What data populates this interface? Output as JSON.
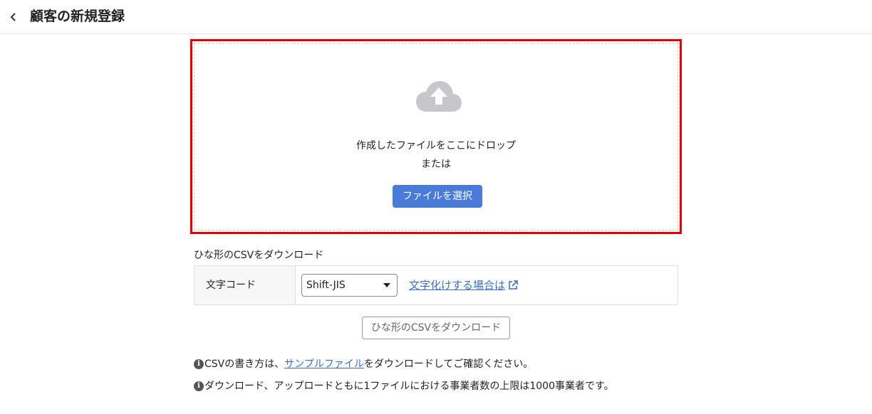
{
  "header": {
    "title": "顧客の新規登録"
  },
  "dropzone": {
    "drop_text": "作成したファイルをここにドロップ",
    "or_text": "または",
    "select_button": "ファイルを選択"
  },
  "template": {
    "section_label": "ひな形のCSVをダウンロード",
    "encoding_label": "文字コード",
    "encoding_value": "Shift-JIS",
    "garble_link": "文字化けする場合は",
    "download_button": "ひな形のCSVをダウンロード"
  },
  "notes": {
    "note1_prefix": "CSVの書き方は、",
    "note1_link": "サンプルファイル",
    "note1_suffix": "をダウンロードしてご確認ください。",
    "note2": "ダウンロード、アップロードともに1ファイルにおける事業者数の上限は1000事業者です。"
  },
  "colors": {
    "accent": "#4a7bd8",
    "highlight_border": "#e00000",
    "link": "#3a6fc4"
  },
  "icons": [
    "chevron-left-icon",
    "cloud-upload-icon",
    "external-link-icon",
    "info-icon",
    "caret-down-icon"
  ]
}
